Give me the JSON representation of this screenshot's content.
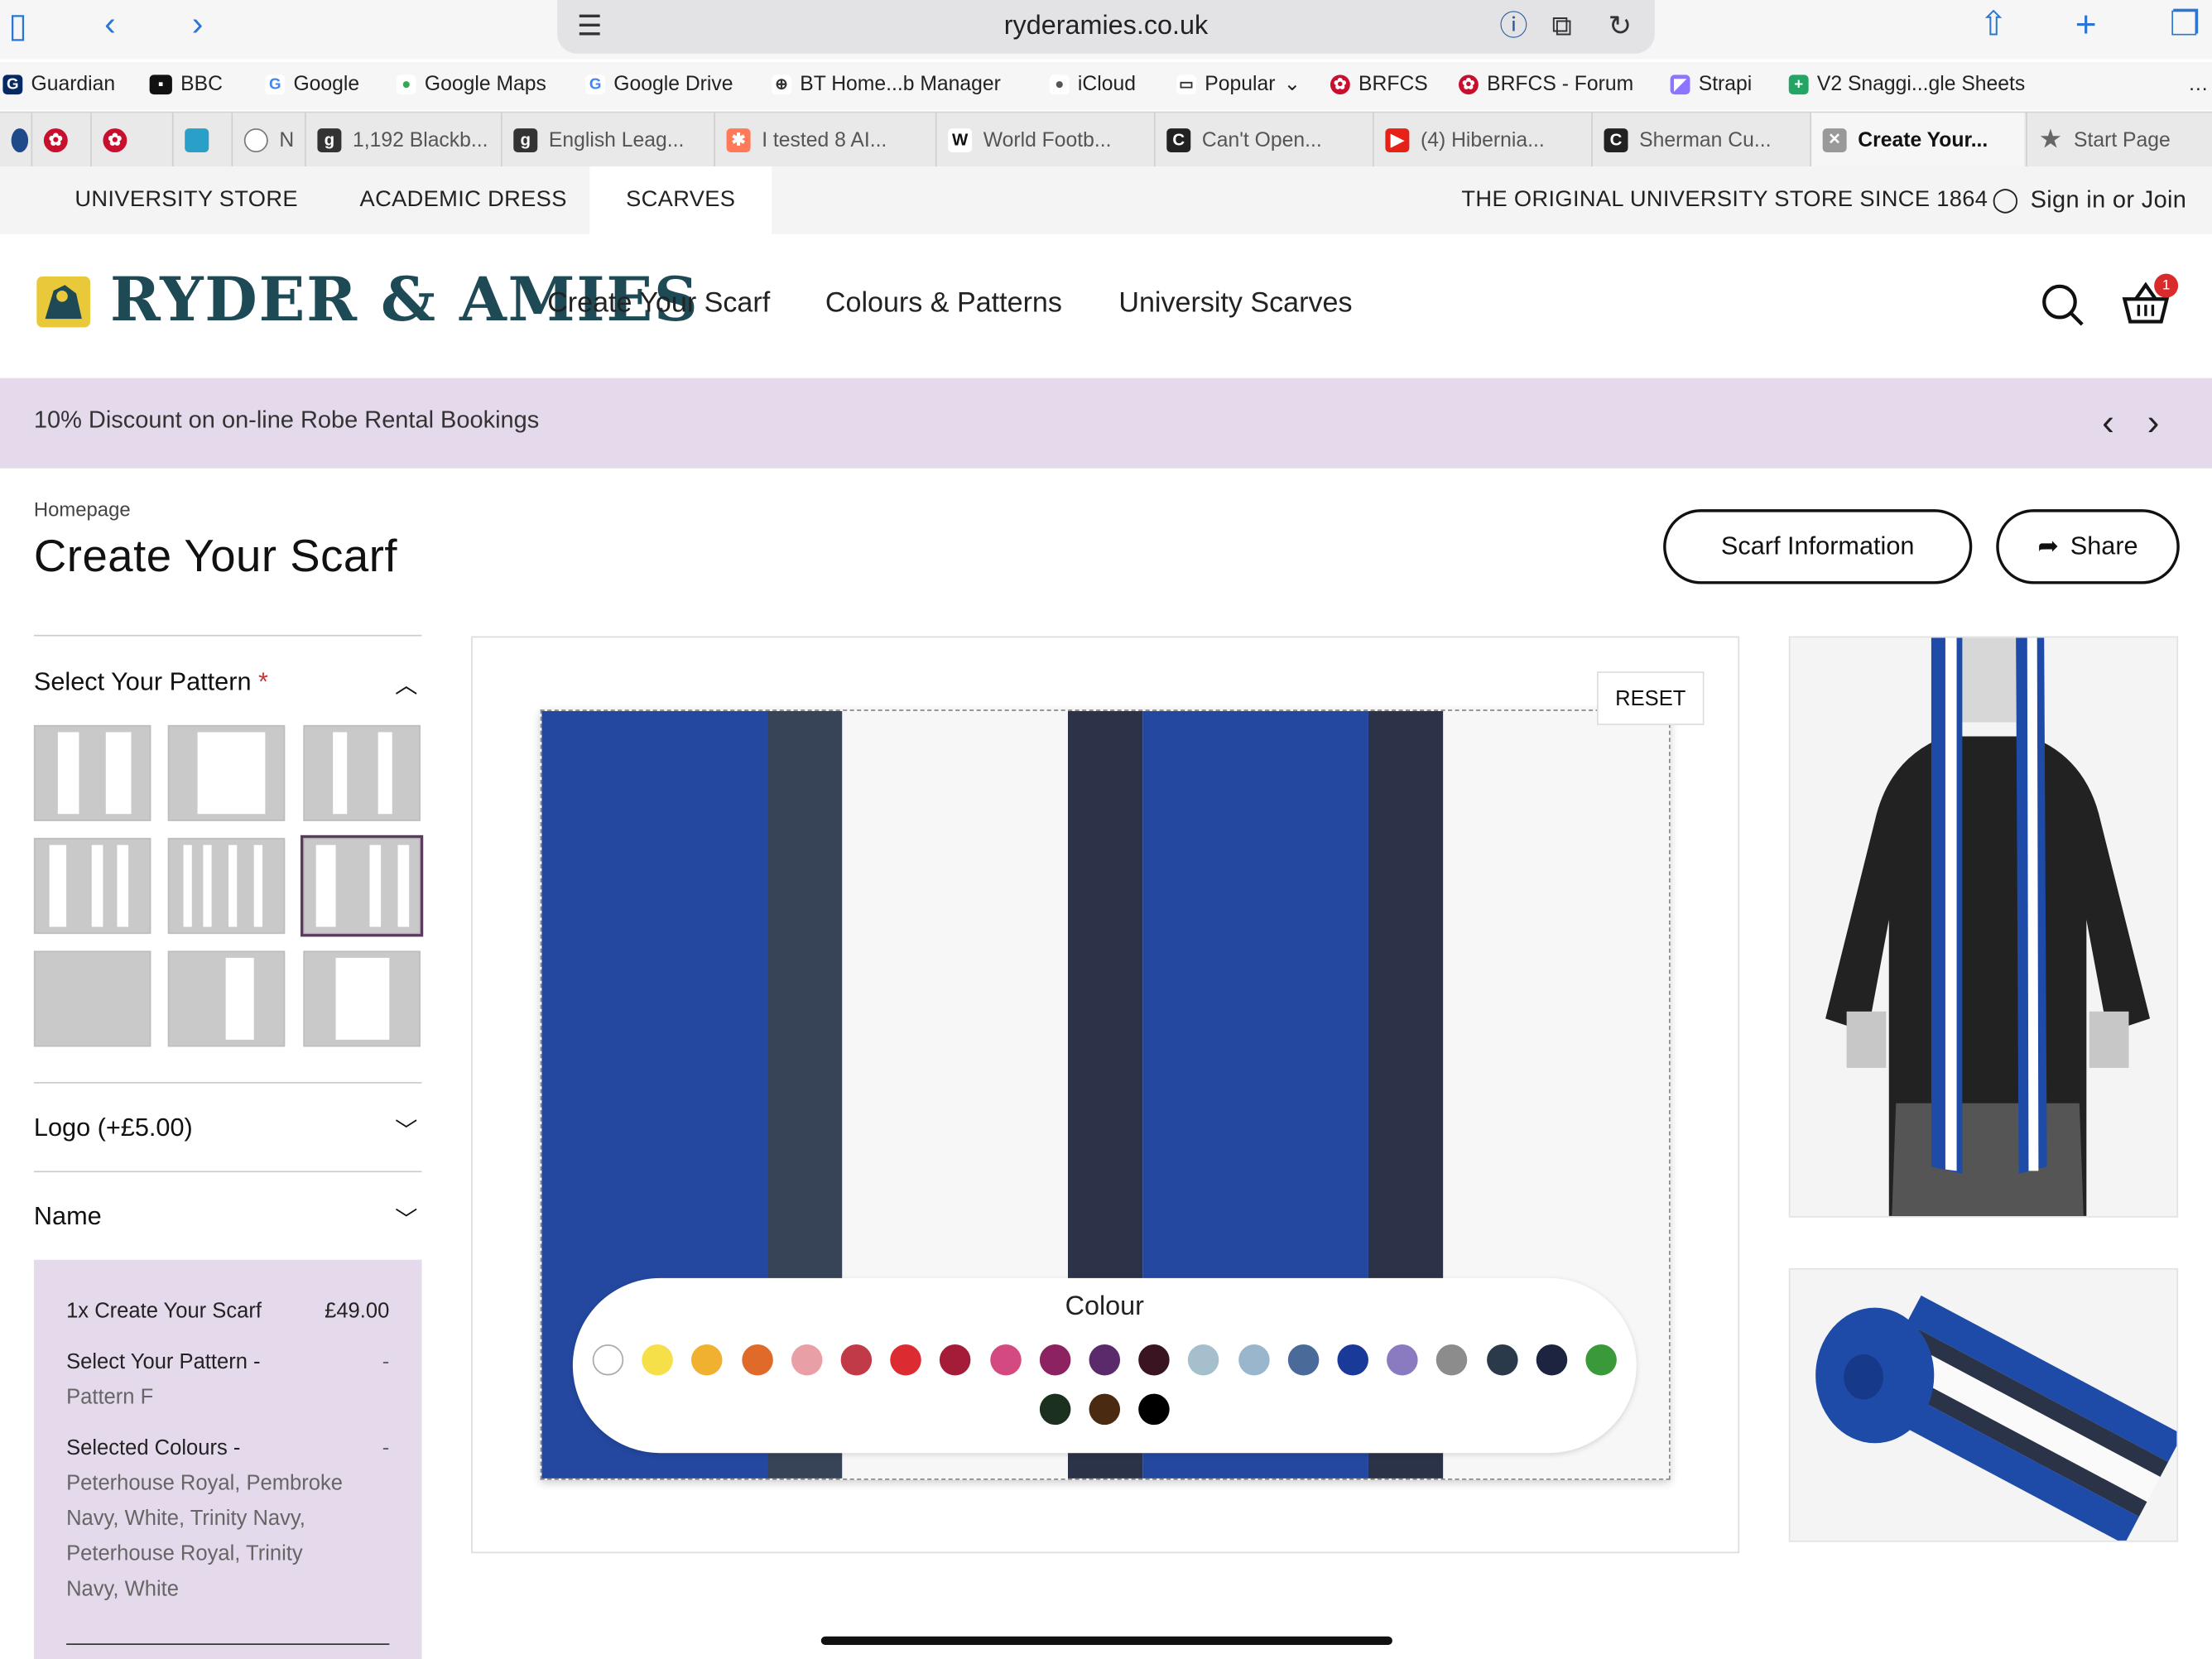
{
  "browser": {
    "url": "ryderamies.co.uk",
    "bookmarks": [
      "Guardian",
      "BBC",
      "Google",
      "Google Maps",
      "Google Drive",
      "BT Home...b Manager",
      "iCloud",
      "Popular",
      "BRFCS",
      "BRFCS - Forum",
      "Strapi",
      "V2 Snaggi...gle Sheets"
    ],
    "tabs": [
      "N",
      "1,192 Blackb...",
      "English Leag...",
      "I tested 8 AI...",
      "World Footb...",
      "Can't Open...",
      "(4) Hibernia...",
      "Sherman Cu...",
      "Create Your...",
      "Start Page"
    ]
  },
  "site": {
    "topnav": [
      "UNIVERSITY STORE",
      "ACADEMIC DRESS",
      "SCARVES"
    ],
    "tagline": "THE ORIGINAL UNIVERSITY STORE SINCE 1864",
    "signin": "Sign in or Join",
    "logo": "RYDER & AMIES",
    "mainnav": [
      "Create Your Scarf",
      "Colours & Patterns",
      "University Scarves"
    ],
    "basket_count": "1",
    "promo": "10% Discount on on-line Robe Rental Bookings"
  },
  "page": {
    "breadcrumb": "Homepage",
    "title": "Create Your Scarf",
    "info_button": "Scarf Information",
    "share_button": "Share",
    "reset": "RESET",
    "colour_label": "Colour"
  },
  "sidebar": {
    "pattern_title": "Select Your Pattern",
    "required_mark": "*",
    "logo_title": "Logo (+£5.00)",
    "name_title": "Name",
    "selected_pattern_index": 5
  },
  "summary": {
    "item": "1x Create Your Scarf",
    "price": "£49.00",
    "pattern_label": "Select Your Pattern -",
    "pattern_value": "Pattern F",
    "colours_label": "Selected Colours -",
    "colours_value": "Peterhouse Royal, Pembroke Navy, White, Trinity Navy, Peterhouse Royal, Trinity Navy, White",
    "dash": "-"
  },
  "colours": {
    "stripes": [
      "#2448a0",
      "#374457",
      "#f7f7f7",
      "#2c3348",
      "#2448a0",
      "#2c3348",
      "#f7f7f7"
    ],
    "swatches": [
      "#ffffff",
      "#f5e04a",
      "#f0b030",
      "#e06a2a",
      "#e8a0a6",
      "#c03a48",
      "#dc2c32",
      "#a51c38",
      "#d44a80",
      "#8c2260",
      "#5a2a6a",
      "#3a1420",
      "#a6bfcc",
      "#9ab6cc",
      "#4a6a9a",
      "#1a3a9a",
      "#8a7ac0",
      "#8c8c8c",
      "#2a3a4a",
      "#1c2440",
      "#3a9a3a",
      "#1c3020",
      "#4a2a10",
      "#000000"
    ]
  }
}
